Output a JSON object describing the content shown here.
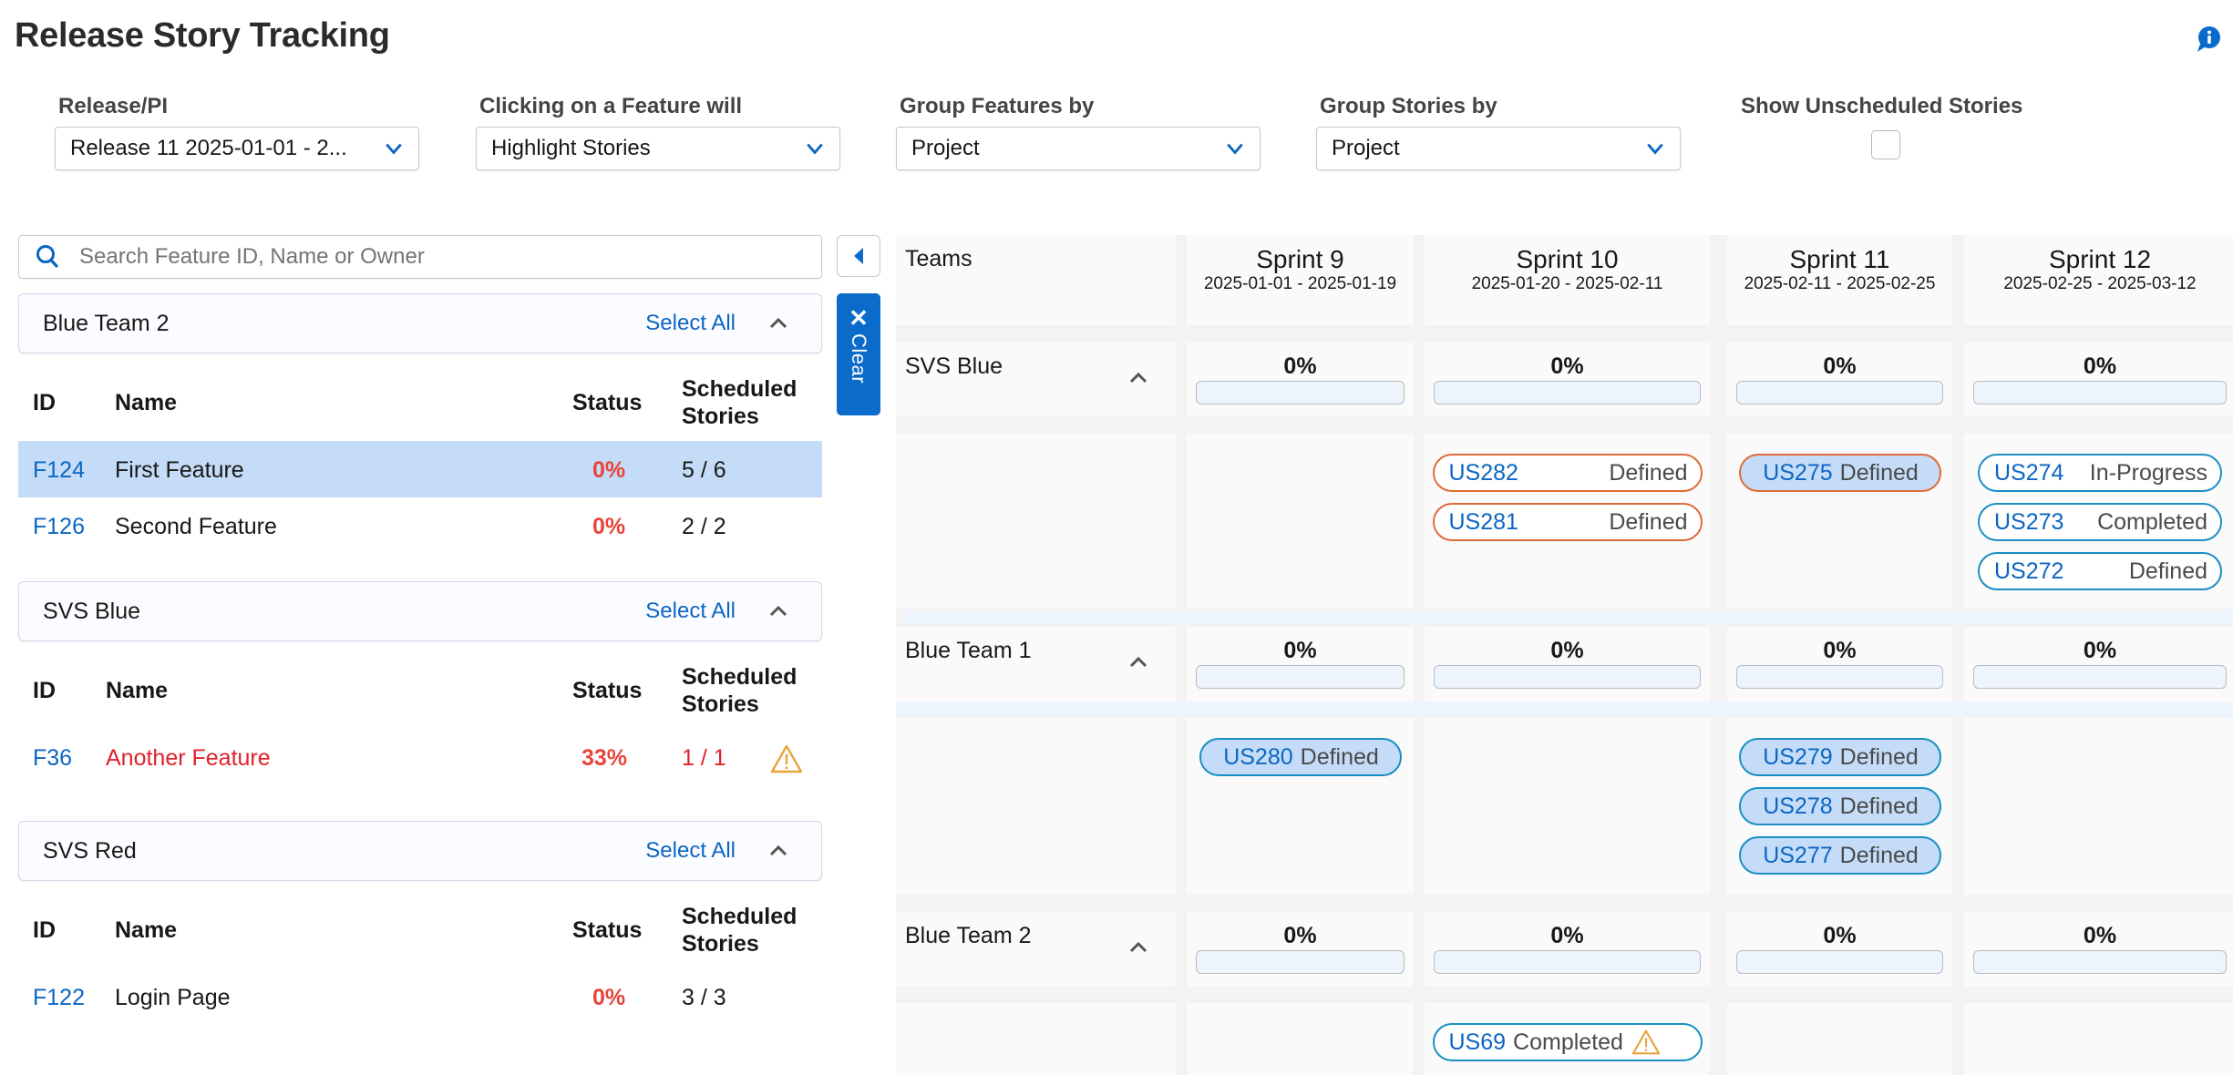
{
  "page": {
    "title": "Release Story Tracking",
    "info_icon": "info-bubble-icon"
  },
  "filters": [
    {
      "label": "Release/PI",
      "value": "Release 11 2025-01-01 - 2..."
    },
    {
      "label": "Clicking on a Feature will",
      "value": "Highlight Stories"
    },
    {
      "label": "Group Features by",
      "value": "Project"
    },
    {
      "label": "Group Stories by",
      "value": "Project"
    }
  ],
  "unscheduled": {
    "label": "Show Unscheduled Stories",
    "checked": false
  },
  "search": {
    "placeholder": "Search Feature ID, Name or Owner",
    "value": ""
  },
  "sidebar": {
    "collapse_icon": "triangle-left-icon",
    "clear_label": "Clear",
    "select_all_label": "Select All",
    "columns": {
      "id": "ID",
      "name": "Name",
      "status": "Status",
      "scheduled_1": "Scheduled",
      "scheduled_2": "Stories"
    },
    "groups": [
      {
        "name": "Blue Team 2",
        "features": [
          {
            "id": "F124",
            "name": "First Feature",
            "status": "0%",
            "scheduled": "5 / 6",
            "selected": true,
            "warning": false
          },
          {
            "id": "F126",
            "name": "Second Feature",
            "status": "0%",
            "scheduled": "2 / 2",
            "selected": false,
            "warning": false
          }
        ]
      },
      {
        "name": "SVS Blue",
        "features": [
          {
            "id": "F36",
            "name": "Another Feature",
            "status": "33%",
            "scheduled": "1 / 1",
            "selected": false,
            "warning": true
          }
        ]
      },
      {
        "name": "SVS Red",
        "features": [
          {
            "id": "F122",
            "name": "Login Page",
            "status": "0%",
            "scheduled": "3 / 3",
            "selected": false,
            "warning": false
          }
        ]
      }
    ]
  },
  "board": {
    "teams_label": "Teams",
    "sprints": [
      {
        "name": "Sprint 9",
        "dates": "2025-01-01 - 2025-01-19"
      },
      {
        "name": "Sprint 10",
        "dates": "2025-01-20 - 2025-02-11"
      },
      {
        "name": "Sprint 11",
        "dates": "2025-02-11 - 2025-02-25"
      },
      {
        "name": "Sprint 12",
        "dates": "2025-02-25 - 2025-03-12"
      }
    ],
    "teams": [
      {
        "name": "SVS Blue",
        "progress": [
          "0%",
          "0%",
          "0%",
          "0%"
        ],
        "progress_values": [
          0,
          0,
          0,
          0
        ],
        "stories": [
          [],
          [
            {
              "id": "US282",
              "status": "Defined",
              "border": "orange",
              "highlight": false,
              "warning": false
            },
            {
              "id": "US281",
              "status": "Defined",
              "border": "orange",
              "highlight": false,
              "warning": false
            }
          ],
          [
            {
              "id": "US275",
              "status": "Defined",
              "border": "orange",
              "highlight": true,
              "warning": false
            }
          ],
          [
            {
              "id": "US274",
              "status": "In-Progress",
              "border": "blue",
              "highlight": false,
              "warning": false
            },
            {
              "id": "US273",
              "status": "Completed",
              "border": "blue",
              "highlight": false,
              "warning": false
            },
            {
              "id": "US272",
              "status": "Defined",
              "border": "blue",
              "highlight": false,
              "warning": false
            }
          ]
        ]
      },
      {
        "name": "Blue Team 1",
        "progress": [
          "0%",
          "0%",
          "0%",
          "0%"
        ],
        "progress_values": [
          0,
          0,
          0,
          0
        ],
        "stories": [
          [
            {
              "id": "US280",
              "status": "Defined",
              "border": "blue",
              "highlight": true,
              "warning": false
            }
          ],
          [],
          [
            {
              "id": "US279",
              "status": "Defined",
              "border": "blue",
              "highlight": true,
              "warning": false
            },
            {
              "id": "US278",
              "status": "Defined",
              "border": "blue",
              "highlight": true,
              "warning": false
            },
            {
              "id": "US277",
              "status": "Defined",
              "border": "blue",
              "highlight": true,
              "warning": false
            }
          ],
          []
        ]
      },
      {
        "name": "Blue Team 2",
        "progress": [
          "0%",
          "0%",
          "0%",
          "0%"
        ],
        "progress_values": [
          0,
          0,
          0,
          0
        ],
        "stories": [
          [],
          [
            {
              "id": "US69",
              "status": "Completed",
              "border": "blue",
              "highlight": false,
              "warning": true
            }
          ],
          [],
          []
        ]
      }
    ]
  },
  "colors": {
    "accent": "#0b6bcb",
    "link": "#0b66c3",
    "danger": "#e8443a",
    "warning": "#e8a33a",
    "selected_row": "#c4dcf7",
    "story_blue": "#1a8fc4",
    "story_orange": "#e06a3a"
  }
}
